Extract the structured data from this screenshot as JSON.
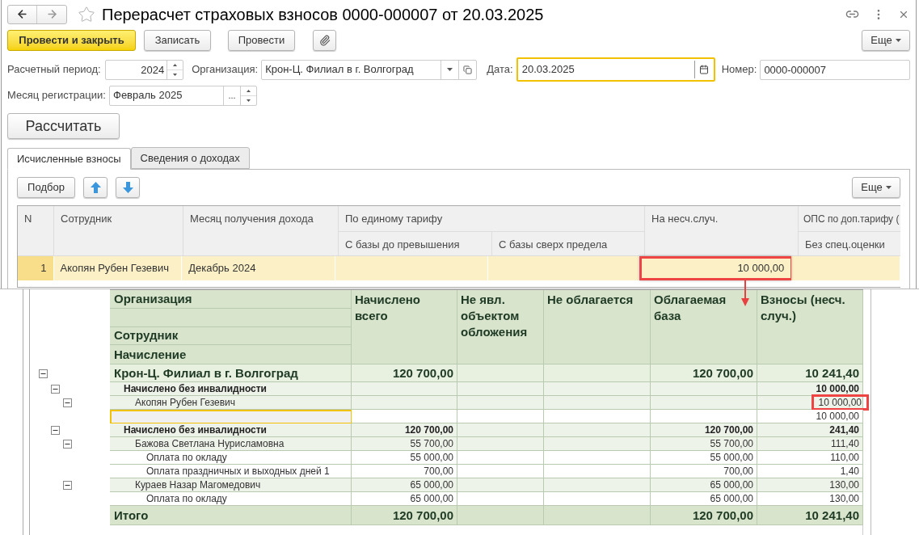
{
  "window": {
    "title": "Перерасчет страховых взносов 0000-000007 от 20.03.2025",
    "favorite": false
  },
  "toolbar": {
    "buttons": [
      {
        "kind": "primary",
        "label": "Провести и закрыть"
      },
      {
        "kind": "plain",
        "label": "Записать"
      },
      {
        "kind": "plain",
        "label": "Провести"
      },
      {
        "kind": "attach"
      }
    ],
    "more": "Еще"
  },
  "fields": {
    "period": {
      "label": "Расчетный период:",
      "value": "2024"
    },
    "organization": {
      "label": "Организация:",
      "value": "Крон-Ц. Филиал в г. Волгоград"
    },
    "date": {
      "label": "Дата:",
      "value": "20.03.2025",
      "focused": true
    },
    "number": {
      "label": "Номер:",
      "value": "0000-000007"
    },
    "month": {
      "label": "Месяц регистрации:",
      "value": "Февраль 2025",
      "select_button": "..."
    }
  },
  "calculate_button": "Рассчитать",
  "tabs": [
    {
      "label": "Исчисленные взносы",
      "selected": true
    },
    {
      "label": "Сведения о доходах",
      "selected": false
    }
  ],
  "table_toolbar": {
    "pick_button": "Подбор",
    "more": "Еще"
  },
  "table": {
    "columns": [
      {
        "label": "N"
      },
      {
        "label": "Сотрудник"
      },
      {
        "label": "Месяц получения дохода"
      },
      {
        "label": "По единому тарифу",
        "children": [
          {
            "label": "С базы до превышения"
          },
          {
            "label": "С базы сверх предела"
          }
        ]
      },
      {
        "label": "На несч.случ."
      },
      {
        "label": "ОПС по доп.тарифу (",
        "children": [
          {
            "label": "Без спец.оценки"
          }
        ]
      }
    ],
    "rows": [
      {
        "selected": true,
        "accident_marked": true,
        "cells": {
          "n": "1",
          "employee": "Акопян Рубен Гезевич",
          "month": "Декабрь 2024",
          "accident": "10 000,00"
        }
      }
    ]
  },
  "report": {
    "label_headers": {
      "organization": "Организация",
      "employee": "Сотрудник",
      "accrual": "Начисление"
    },
    "columns": [
      "Начислено всего",
      "Не явл. объектом обложения",
      "Не облагается",
      "Облагаемая база",
      "Взносы (несч. случ.)"
    ],
    "rows": [
      {
        "kind": "org",
        "label": "Крон-Ц. Филиал в г. Волгоград",
        "values": {
          "accrued": "120 700,00",
          "base": "120 700,00",
          "contributions": "10 241,40"
        },
        "marked": false,
        "focused": false,
        "expanded": true,
        "children": [
          {
            "kind": "group",
            "label": "Начислено без инвалидности",
            "values": {
              "contributions": "10 000,00"
            },
            "marked": false,
            "focused": false,
            "expanded": true,
            "children": [
              {
                "kind": "employee",
                "label": "Акопян Рубен Гезевич",
                "values": {
                  "contributions": "10 000,00"
                },
                "marked": true,
                "focused": false,
                "expanded": true,
                "children": [
                  {
                    "kind": "accrual",
                    "values": {
                      "contributions": "10 000,00"
                    },
                    "marked": false,
                    "focused": true
                  }
                ]
              }
            ]
          },
          {
            "kind": "group",
            "label": "Начислено без инвалидности",
            "values": {
              "accrued": "120 700,00",
              "base": "120 700,00",
              "contributions": "241,40"
            },
            "marked": false,
            "focused": false,
            "expanded": true,
            "children": [
              {
                "kind": "employee",
                "label": "Бажова Светлана Нурисламовна",
                "values": {
                  "accrued": "55 700,00",
                  "base": "55 700,00",
                  "contributions": "111,40"
                },
                "marked": false,
                "focused": false,
                "expanded": true,
                "children": [
                  {
                    "kind": "accrual",
                    "label": "Оплата по окладу",
                    "values": {
                      "accrued": "55 000,00",
                      "base": "55 000,00",
                      "contributions": "110,00"
                    },
                    "marked": false,
                    "focused": false
                  },
                  {
                    "kind": "accrual",
                    "label": "Оплата праздничных и выходных дней 1",
                    "values": {
                      "accrued": "700,00",
                      "base": "700,00",
                      "contributions": "1,40"
                    },
                    "marked": false,
                    "focused": false
                  }
                ]
              },
              {
                "kind": "employee",
                "label": "Кураев Назар Магомедович",
                "values": {
                  "accrued": "65 000,00",
                  "base": "65 000,00",
                  "contributions": "130,00"
                },
                "marked": false,
                "focused": false,
                "expanded": true,
                "children": [
                  {
                    "kind": "accrual",
                    "label": "Оплата по окладу",
                    "values": {
                      "accrued": "65 000,00",
                      "base": "65 000,00",
                      "contributions": "130,00"
                    },
                    "marked": false,
                    "focused": false
                  }
                ]
              }
            ]
          }
        ]
      }
    ],
    "total": {
      "label": "Итого",
      "values": {
        "accrued": "120 700,00",
        "base": "120 700,00",
        "contributions": "10 241,40"
      }
    }
  }
}
